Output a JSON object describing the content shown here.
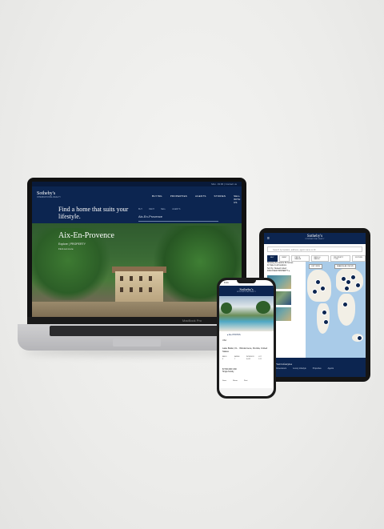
{
  "laptop": {
    "top_links": "Mon. 19:00 | Contact us",
    "logo": "Sotheby's",
    "logo_sub": "INTERNATIONAL REALTY",
    "tagline": "Find a home that suits your lifestyle.",
    "nav": [
      "BUYING",
      "PROPERTIES",
      "AGENTS",
      "STORIES",
      "SELL WITH US"
    ],
    "search_tabs": [
      "BUY",
      "RENT",
      "SELL",
      "AGENTS"
    ],
    "search_value": "Aix-En-Provence",
    "hero_title": "Aix-En-Provence",
    "hero_sub": "Explore | PROPERTY",
    "hero_sub2": "Find out more",
    "chin_label": "MacBook Pro"
  },
  "tablet": {
    "logo": "Sotheby's",
    "logo_sub": "INTERNATIONAL REALTY",
    "search_placeholder": "Search by location, address, agent name or ID",
    "filters": [
      "BUY",
      "RENT",
      "PRICE RANGE",
      "BEDS & BATHS",
      "PROPERTY TYPE",
      "FILTERS"
    ],
    "list_text": [
      "Showing the world's 50 homes",
      "for Sale in all locations",
      "",
      "Sort by: Newest Listed",
      "DISCOVER PROPERTY ▸"
    ],
    "map_buttons": [
      "LIST VIEW",
      "SEARCH AS I MOVE"
    ],
    "footer_title": "Find Lifestyles",
    "footer_links": [
      "Homeowners",
      "Luxury Lifestyle",
      "Properties",
      "Agents"
    ]
  },
  "phone": {
    "time": "9:41",
    "logo": "Sotheby's",
    "logo_sub": "INTERNATIONAL REALTY",
    "tag": "▸ ALL PHOTOS",
    "location_label": "USA",
    "title": "Lake Butler, FL · Windermere, Florida, United States",
    "grid": [
      "BEDS",
      "BATHS",
      "INTERIOR",
      "LOT",
      "6",
      "7",
      "6,642",
      "1.22"
    ],
    "price": "$7,500,000 USD",
    "price_sub": "Single Family",
    "actions": [
      "Save",
      "Share",
      "Print"
    ]
  }
}
